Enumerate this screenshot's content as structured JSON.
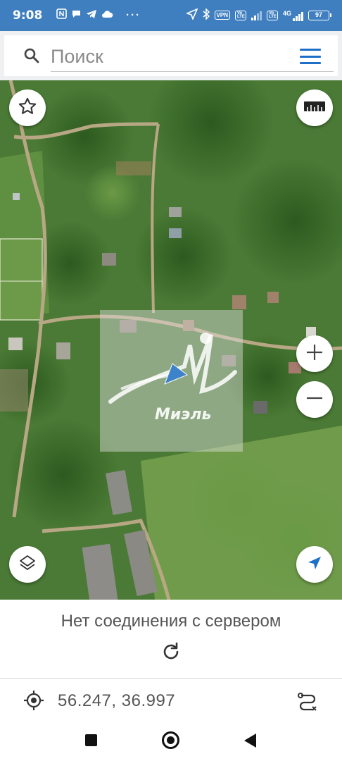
{
  "status_bar": {
    "time": "9:08",
    "left_icons": [
      "nfc-icon",
      "chat-icon",
      "telegram-icon",
      "cloud-icon",
      "more-icon"
    ],
    "vpn_label": "VPN",
    "volte_label": "Vo LTE",
    "network_label": "4G",
    "battery": "97"
  },
  "search": {
    "placeholder": "Поиск",
    "value": ""
  },
  "map": {
    "watermark_text": "Миэль",
    "buttons": {
      "favorite": "star-icon",
      "ruler": "ruler-icon",
      "zoom_in": "plus-icon",
      "zoom_out": "minus-icon",
      "layers": "layers-icon",
      "location": "navigation-arrow-icon"
    }
  },
  "panel": {
    "connection_status": "Нет соединения с сервером"
  },
  "coordinates": {
    "value": "56.247, 36.997"
  },
  "colors": {
    "status_bar": "#3f7fc0",
    "accent": "#1e6fc8",
    "map_green": "#3f6b2c"
  }
}
